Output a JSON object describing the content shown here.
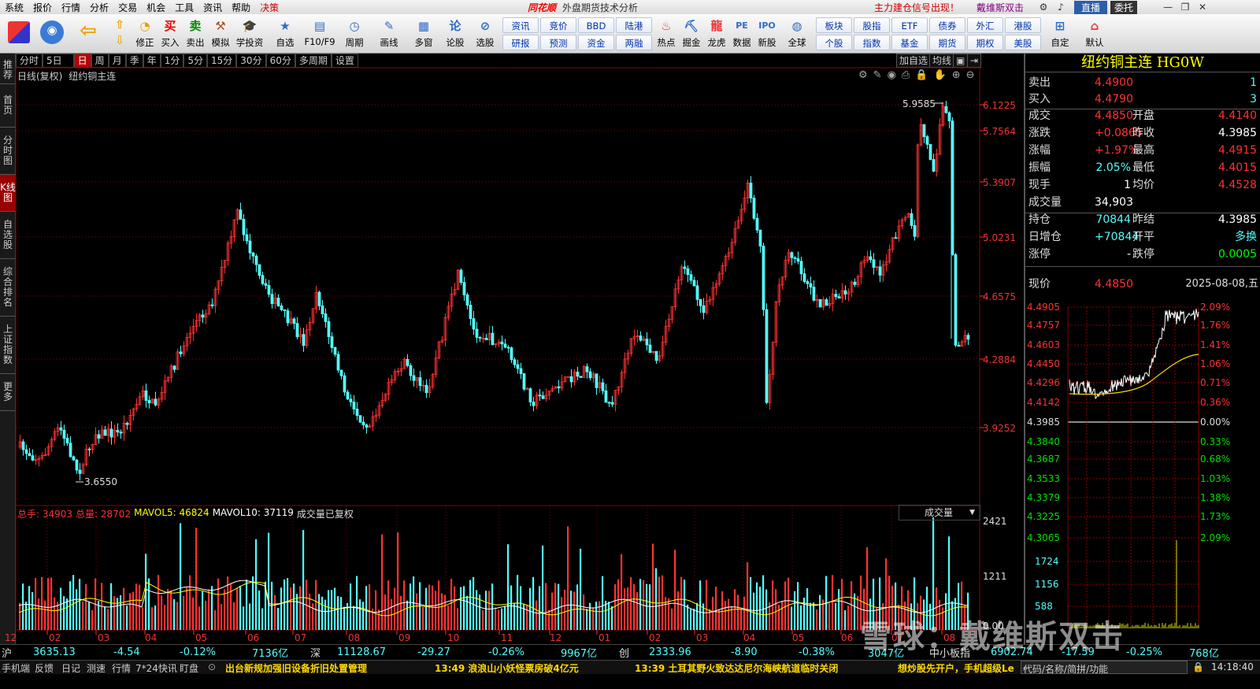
{
  "menu": {
    "items": [
      "系统",
      "报价",
      "行情",
      "分析",
      "交易",
      "机会",
      "工具",
      "资讯",
      "帮助",
      "决策"
    ],
    "app_logo": "同花顺",
    "window_title": "外盘期货技术分析",
    "notice": "主力建仓信号出现！",
    "user": "戴维斯双击",
    "live_btn": "直播",
    "entrust_btn": "委托"
  },
  "toolbar": {
    "icons": [
      {
        "label": "",
        "icon": "grid-icon"
      },
      {
        "label": "",
        "icon": "robot-icon"
      },
      {
        "label": "",
        "icon": "back-arrow-icon"
      },
      {
        "label": "修正",
        "icon": "updown-icon"
      },
      {
        "label": "买入",
        "icon": "buy-icon"
      },
      {
        "label": "卖出",
        "icon": "sell-icon"
      },
      {
        "label": "模拟",
        "icon": "hammer-icon"
      },
      {
        "label": "学投资",
        "icon": "graduation-icon"
      },
      {
        "label": "自选",
        "icon": "star-icon"
      },
      {
        "label": "F10/F9",
        "icon": "f10-icon"
      },
      {
        "label": "周期",
        "icon": "clock-icon"
      },
      {
        "label": "画线",
        "icon": "pen-icon"
      },
      {
        "label": "多窗",
        "icon": "windows-icon"
      },
      {
        "label": "论股",
        "icon": "discuss-icon"
      },
      {
        "label": "选股",
        "icon": "pick-icon"
      }
    ],
    "small_buttons": [
      {
        "top": "资讯",
        "bottom": "研报"
      },
      {
        "top": "竞价",
        "bottom": "预测"
      },
      {
        "top": "BBD",
        "bottom": "资金"
      },
      {
        "top": "陆港",
        "bottom": "两融"
      }
    ],
    "icons2": [
      {
        "label": "热点",
        "icon": "hot-icon"
      },
      {
        "label": "掘金",
        "icon": "gold-icon"
      },
      {
        "label": "龙虎",
        "icon": "dragon-icon"
      },
      {
        "label": "数据",
        "icon": "pe-icon"
      },
      {
        "label": "新股",
        "icon": "ipo-icon"
      },
      {
        "label": "全球",
        "icon": "globe-icon"
      }
    ],
    "small_buttons2": [
      {
        "top": "板块",
        "bottom": "个股"
      },
      {
        "top": "股指",
        "bottom": "指数"
      },
      {
        "top": "ETF",
        "bottom": "基金"
      },
      {
        "top": "债券",
        "bottom": "期货"
      },
      {
        "top": "外汇",
        "bottom": "期权"
      },
      {
        "top": "港股",
        "bottom": "美股"
      }
    ],
    "icons3": [
      {
        "label": "自定",
        "icon": "custom-icon"
      },
      {
        "label": "默认",
        "icon": "home-icon"
      }
    ]
  },
  "left_sidebar": [
    "推荐",
    "首页",
    "分时图",
    "K线图",
    "自选股",
    "综合排名",
    "上证指数",
    "更多"
  ],
  "periods": [
    "分时",
    "5日",
    "日",
    "周",
    "月",
    "季",
    "年",
    "1分",
    "5分",
    "15分",
    "30分",
    "60分",
    "多周期",
    "设置"
  ],
  "active_period": "日",
  "chart_toolbar": {
    "add_watch": "加自选",
    "avg_line": "均线"
  },
  "chart": {
    "title": "日线(复权)",
    "symbol": "纽约铜主连",
    "price_axis": [
      "6.1225",
      "5.7564",
      "5.3907",
      "5.0231",
      "4.6575",
      "4.2884",
      "3.9252"
    ],
    "high_label": "5.9585",
    "low_label": "3.6550",
    "months": [
      "12",
      "02",
      "03",
      "04",
      "05",
      "06",
      "07",
      "08",
      "09",
      "10",
      "11",
      "12",
      "01",
      "02",
      "03",
      "04",
      "05",
      "06",
      "07",
      "08"
    ],
    "colors": {
      "up": "#ff3232",
      "down": "#54fcfc",
      "grid": "#8b0000",
      "ma5": "#ffff00",
      "ma10": "#ffffff"
    }
  },
  "chart_data": {
    "type": "candlestick",
    "title": "纽约铜主连 日线(复权)",
    "ylim": [
      3.6,
      6.15
    ],
    "high": 5.9585,
    "low": 3.655,
    "last_close": 4.485,
    "volume": {
      "total": 34903,
      "now": 28702,
      "mavol5": 46824,
      "mavol10": 37119,
      "ylim": [
        0,
        2421
      ]
    }
  },
  "volume": {
    "total_label": "总手: 34903",
    "now_label": "总量: 28702",
    "ma5_label": "MAVOL5: 46824",
    "ma10_label": "MAVOL10: 37119",
    "note": "成交量已复权",
    "selector": "成交量",
    "axis": [
      "2421",
      "1211",
      "0.00"
    ]
  },
  "quote": {
    "title": "纽约铜主连 HG0W",
    "sell": {
      "label": "卖出",
      "price": "4.4900",
      "qty": "1"
    },
    "buy": {
      "label": "买入",
      "price": "4.4790",
      "qty": "3"
    },
    "rows": [
      {
        "l1": "成交",
        "v1": "4.4850",
        "l2": "开盘",
        "v2": "4.4140",
        "c1": "#ff3232",
        "c2": "#ff3232"
      },
      {
        "l1": "涨跌",
        "v1": "+0.0865",
        "l2": "昨收",
        "v2": "4.3985",
        "c1": "#ff3232",
        "c2": "#ffffff"
      },
      {
        "l1": "涨幅",
        "v1": "+1.97%",
        "l2": "最高",
        "v2": "4.4915",
        "c1": "#ff3232",
        "c2": "#ff3232"
      },
      {
        "l1": "振幅",
        "v1": "2.05%",
        "l2": "最低",
        "v2": "4.4015",
        "c1": "#54fcfc",
        "c2": "#ff3232"
      },
      {
        "l1": "现手",
        "v1": "1",
        "l2": "均价",
        "v2": "4.4528",
        "c1": "#ffffff",
        "c2": "#ff3232"
      },
      {
        "l1": "成交量",
        "v1": "34,903",
        "l2": "",
        "v2": "",
        "c1": "#ffffff",
        "c2": "#ffffff"
      }
    ],
    "rows2": [
      {
        "l1": "持仓",
        "v1": "70844",
        "l2": "昨结",
        "v2": "4.3985",
        "c1": "#54fcfc",
        "c2": "#ffffff"
      },
      {
        "l1": "日增仓",
        "v1": "+70844",
        "l2": "开平",
        "v2": "多换",
        "c1": "#54fcfc",
        "c2": "#54fcfc"
      },
      {
        "l1": "涨停",
        "v1": "-",
        "l2": "跌停",
        "v2": "0.0005",
        "c1": "#ffffff",
        "c2": "#00ff00"
      }
    ],
    "now_label": "现价",
    "now_price": "4.4850",
    "date": "2025-08-08,五"
  },
  "intraday": {
    "prices": [
      "4.4905",
      "4.4757",
      "4.4603",
      "4.4450",
      "4.4296",
      "4.4142",
      "4.3985",
      "4.3840",
      "4.3687",
      "4.3533",
      "4.3379",
      "4.3225",
      "4.3065"
    ],
    "pcts": [
      "2.09%",
      "1.76%",
      "1.41%",
      "1.06%",
      "0.71%",
      "0.36%",
      "0.00%",
      "0.33%",
      "0.68%",
      "1.03%",
      "1.38%",
      "1.73%",
      "2.09%"
    ],
    "vols": [
      "1724",
      "1156",
      "588"
    ]
  },
  "status": {
    "sh": {
      "name": "沪",
      "value": "3635.13",
      "chg": "-4.54",
      "pct": "-0.12%",
      "amt": "7136亿"
    },
    "sz": {
      "name": "深",
      "value": "11128.67",
      "chg": "-29.27",
      "pct": "-0.26%",
      "amt": "9967亿"
    },
    "cy": {
      "name": "创",
      "value": "2333.96",
      "chg": "-8.90",
      "pct": "-0.38%",
      "amt": "3047亿"
    },
    "zx": {
      "name": "中小板指",
      "value": "6902.74",
      "chg": "-17.59",
      "pct": "-0.25%",
      "amt": "768亿"
    }
  },
  "taskbar": {
    "items": [
      "手机端",
      "反馈",
      "日记",
      "测速",
      "行情",
      "7*24快讯",
      "盯盘"
    ],
    "news1": "出台新规加强旧设备折旧处置管理",
    "news2": "13:49 浪浪山小妖怪票房破4亿元",
    "news3": "13:39 土耳其野火致达达尼尔海峡航道临时关闭",
    "news4": "想炒股先开户，手机超级Le",
    "code_input": "代码/名称/简拼/功能",
    "time": "14:18:40"
  },
  "watermark": "雪球：戴维斯双击"
}
